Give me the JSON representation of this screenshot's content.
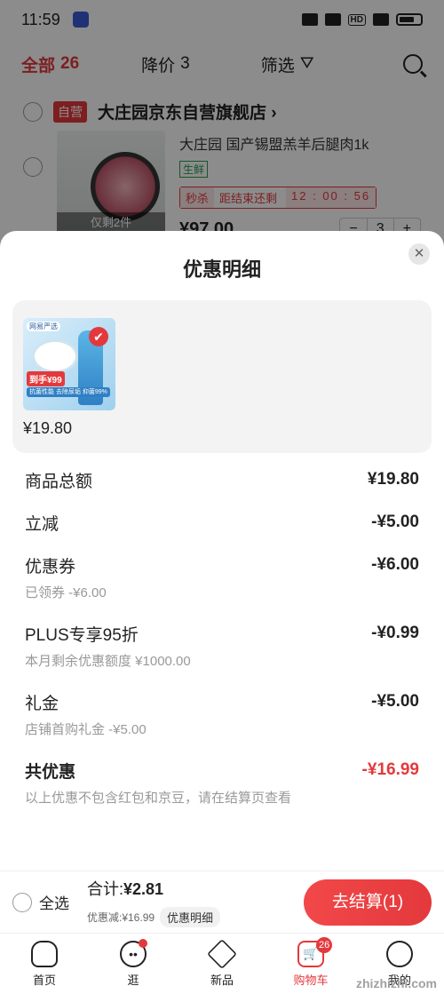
{
  "status_bar": {
    "time": "11:59",
    "network": "HD"
  },
  "cart_tabs": {
    "all_label": "全部",
    "all_count": "26",
    "price_drop_label": "降价",
    "price_drop_count": "3",
    "filter_label": "筛选"
  },
  "shop": {
    "self_tag": "自营",
    "name": "大庄园京东自营旗舰店 ›",
    "product_name": "大庄园 国产锡盟羔羊后腿肉1k",
    "tag": "生鲜",
    "seckill_label": "秒杀",
    "countdown_prefix": "距结束还剩",
    "countdown": "12 : 00 : 56",
    "stock_hint": "仅剩2件",
    "price": "¥97.00",
    "qty_minus": "−",
    "qty_value": "3",
    "qty_plus": "+"
  },
  "sheet": {
    "title": "优惠明细",
    "close_symbol": "✕",
    "goods": {
      "price": "¥19.80",
      "badge": "网易严选",
      "promo": "到手¥99",
      "features": "抗菌性能 去除尿垢 抑菌99%",
      "check_symbol": "✔"
    },
    "lines": [
      {
        "label": "商品总额",
        "amount": "¥19.80",
        "sub": ""
      },
      {
        "label": "立减",
        "amount": "-¥5.00",
        "sub": ""
      },
      {
        "label": "优惠券",
        "amount": "-¥6.00",
        "sub": "已领券 -¥6.00"
      },
      {
        "label": "PLUS专享95折",
        "amount": "-¥0.99",
        "sub": "本月剩余优惠额度 ¥1000.00"
      },
      {
        "label": "礼金",
        "amount": "-¥5.00",
        "sub": "店铺首购礼金 -¥5.00"
      }
    ],
    "total": {
      "label": "共优惠",
      "amount": "-¥16.99",
      "note": "以上优惠不包含红包和京豆，请在结算页查看"
    }
  },
  "checkout": {
    "select_all": "全选",
    "sum_label": "合计:",
    "sum_value": "¥2.81",
    "discount_text": "优惠减:¥16.99",
    "detail_chip": "优惠明细",
    "button": "去结算(1)"
  },
  "tabbar": {
    "items": [
      {
        "label": "首页",
        "icon": "home-icon"
      },
      {
        "label": "逛",
        "icon": "face-icon"
      },
      {
        "label": "新品",
        "icon": "cube-icon"
      },
      {
        "label": "购物车",
        "icon": "cart-icon",
        "badge": "26"
      },
      {
        "label": "我的",
        "icon": "user-icon"
      }
    ]
  },
  "watermark": "zhizhizhi.com",
  "colors": {
    "accent": "#e4393c",
    "fresh": "#2a9d4b"
  }
}
